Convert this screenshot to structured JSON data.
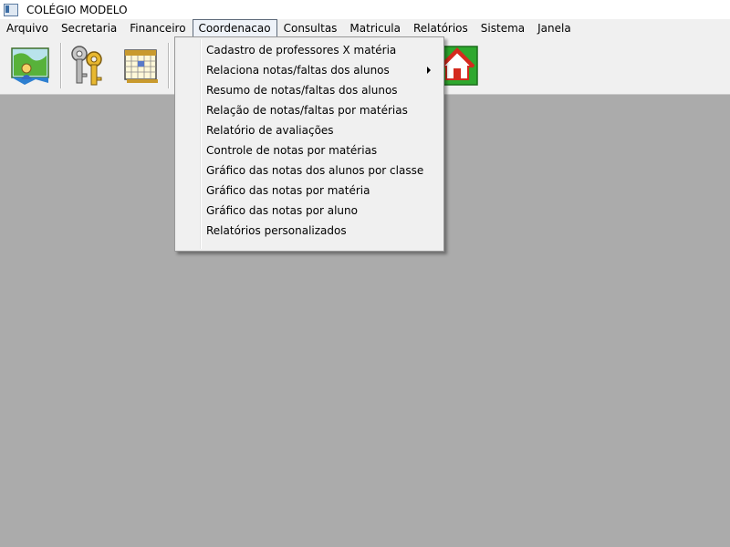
{
  "window": {
    "title": "COLÉGIO MODELO"
  },
  "menu": [
    "Arquivo",
    "Secretaria",
    "Financeiro",
    "Coordenacao",
    "Consultas",
    "Matricula",
    "Relatórios",
    "Sistema",
    "Janela"
  ],
  "active_menu": "Coordenacao",
  "dropdown": [
    {
      "label": "Cadastro de professores X matéria",
      "submenu": false
    },
    {
      "label": "Relaciona notas/faltas dos alunos",
      "submenu": true
    },
    {
      "label": "Resumo de notas/faltas dos alunos",
      "submenu": false
    },
    {
      "label": "Relação de notas/faltas por matérias",
      "submenu": false
    },
    {
      "label": "Relatório de avaliações",
      "submenu": false
    },
    {
      "label": "Controle de notas por matérias",
      "submenu": false
    },
    {
      "label": "Gráfico das notas dos alunos por classe",
      "submenu": false
    },
    {
      "label": "Gráfico das notas por matéria",
      "submenu": false
    },
    {
      "label": "Gráfico das notas por aluno",
      "submenu": false
    },
    {
      "label": "Relatórios personalizados",
      "submenu": false
    }
  ],
  "toolbar": [
    {
      "icon": "student-map-icon"
    },
    {
      "icon": "keys-icon"
    },
    {
      "icon": "calendar-icon"
    },
    {
      "icon": "home-icon"
    }
  ],
  "colors": {
    "desktop": "#ababab",
    "chrome": "#f0f0f0",
    "home_green": "#2ea82e",
    "home_red": "#d42a1e"
  }
}
